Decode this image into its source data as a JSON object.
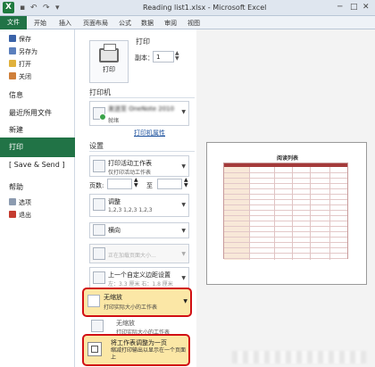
{
  "window": {
    "title": "Reading list1.xlsx - Microsoft Excel",
    "app_icon_letter": "X"
  },
  "ribbon": {
    "tabs": [
      "文件",
      "开始",
      "插入",
      "页面布局",
      "公式",
      "数据",
      "审阅",
      "视图"
    ]
  },
  "nav": {
    "save": "保存",
    "save_as": "另存为",
    "open": "打开",
    "close": "关闭",
    "info": "信息",
    "recent": "最近所用文件",
    "new": "新建",
    "print": "打印",
    "save_send": "[ Save & Send ]",
    "help": "帮助",
    "options": "选项",
    "exit": "退出"
  },
  "print_panel": {
    "section_title": "打印",
    "print_button": "打印",
    "copies_label": "副本：",
    "copies_value": "1",
    "printer_heading": "打印机",
    "printer_name": "发送至 OneNote 2010",
    "printer_status": "就绪",
    "printer_props_link": "打印机属性",
    "settings_heading": "设置",
    "what_main": "打印活动工作表",
    "what_sub": "仅打印活动工作表",
    "pages_label": "页数:",
    "pages_to": "至",
    "collate_main": "调整",
    "collate_sub": "1,2,3    1,2,3    1,2,3",
    "orientation": "横向",
    "paper_size": "正在加载页面大小...",
    "margins_main": "上一个自定义边距设置",
    "margins_sub": "左：3.3 厘米    右：1.8 厘米",
    "scaling_main": "无缩放",
    "scaling_sub": "打印实际大小的工作表",
    "scaling_opt1_main": "无缩放",
    "scaling_opt1_sub": "打印实际大小的工作表",
    "scaling_opt2_main": "将工作表调整为一页",
    "scaling_opt2_sub": "缩减打印输出以显示在一个页面上"
  },
  "preview": {
    "doc_title": "阅读列表"
  },
  "colors": {
    "accent_green": "#217346",
    "highlight_red": "#d10f14",
    "highlight_fill": "#fbe7a6",
    "sheet_header": "#a43a3a"
  }
}
